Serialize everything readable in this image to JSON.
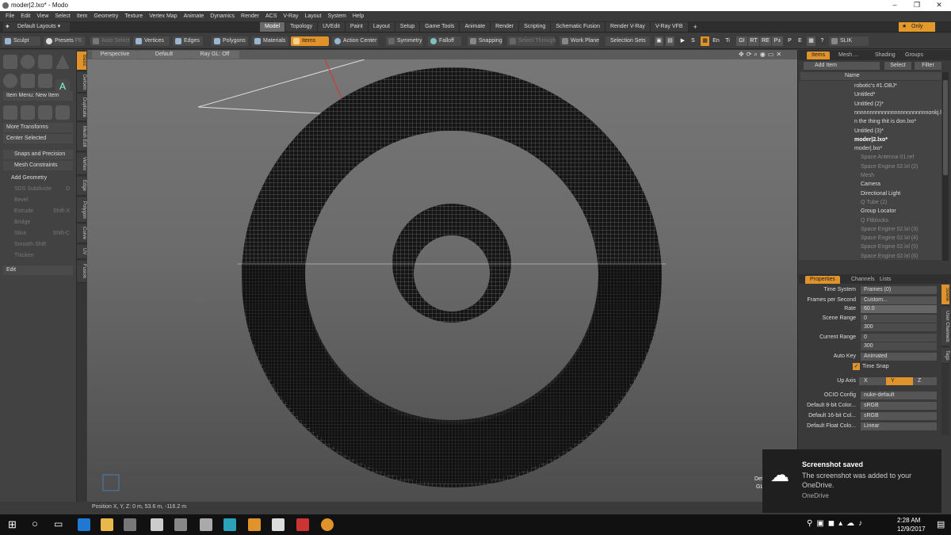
{
  "window": {
    "title": "moder|2.lxo* - Modo",
    "min": "–",
    "max": "❐",
    "close": "✕"
  },
  "menu": [
    "File",
    "Edit",
    "View",
    "Select",
    "Item",
    "Geometry",
    "Texture",
    "Vertex Map",
    "Animate",
    "Dynamics",
    "Render",
    "ACS",
    "V-Ray",
    "Layout",
    "System",
    "Help"
  ],
  "layout": {
    "selector": "Default Layouts ▾",
    "tabs": [
      "Model",
      "Topology",
      "UVEdit",
      "Paint",
      "Layout",
      "Setup",
      "Game Tools",
      "Animate",
      "Render",
      "Scripting",
      "Schematic Fusion",
      "Render V-Ray",
      "V-Ray VFB"
    ],
    "active": "Model",
    "add": "+",
    "only": "Only"
  },
  "toolbar": {
    "sculpt": "Sculpt",
    "presets": "Presets",
    "presets_key": "F6",
    "autoselect": "Auto Select",
    "vertices": "Vertices",
    "edges": "Edges",
    "polygons": "Polygons",
    "materials": "Materials",
    "items": "Items",
    "action_center": "Action Center",
    "symmetry": "Symmetry",
    "falloff": "Falloff",
    "snapping": "Snapping",
    "select_through": "Select Through",
    "work_plane": "Work Plane",
    "selection_sets": "Selection Sets",
    "s": "S",
    "en": "En",
    "ti": "Ti",
    "gi": "GI",
    "rt": "RT",
    "re": "RE",
    "pt": "P±",
    "p": "P",
    "e": "E",
    "help": "?",
    "slik": "SLIK"
  },
  "left": {
    "item_menu": "Item Menu: New Item",
    "more_transforms": "More Transforms",
    "center_selected": "Center Selected",
    "snaps": "Snaps and Precision",
    "mesh_constraints": "Mesh Constraints",
    "add_geometry": "Add Geometry",
    "sds": "SDS Subdivide",
    "sds_key": "D",
    "bevel": "Bevel",
    "extrude": "Extrude",
    "extrude_key": "Shift-X",
    "bridge": "Bridge",
    "slice": "Slice",
    "slice_key": "Shift-C",
    "smooth_shift": "Smooth Shift",
    "thicken": "Thicken",
    "edit": "Edit",
    "vtabs": [
      "Basic",
      "Deform",
      "Duplicate",
      "Mesh Edit",
      "Vertex",
      "Edge",
      "Polygon",
      "Curve",
      "UV",
      "Fusion"
    ]
  },
  "viewport": {
    "perspective": "Perspective",
    "default": "Default",
    "ray_gl": "Ray GL: Off",
    "corner_a": "Def",
    "corner_b": "GL"
  },
  "status": "Position X, Y, Z:   0 m, 53.6 m, -116.2 m",
  "items": {
    "tabs": [
      "Items",
      "Mesh ...",
      "Shading",
      "Groups"
    ],
    "add_item": "Add Item",
    "select": "Select",
    "filter": "Filter",
    "name_col": "Name",
    "rows": [
      {
        "name": "robotic's #1.OBJ*",
        "style": "normal",
        "indent": 0
      },
      {
        "name": "Untitled*",
        "style": "normal",
        "indent": 0
      },
      {
        "name": "Untitled (2)*",
        "style": "normal",
        "indent": 0
      },
      {
        "name": "nnnnnnnnnnnnnnnnnnnnnnnnonkj.lxo*",
        "style": "normal",
        "indent": 0
      },
      {
        "name": "n the thing thit is don.lxo*",
        "style": "normal",
        "indent": 0
      },
      {
        "name": "Untitled (3)*",
        "style": "normal",
        "indent": 0
      },
      {
        "name": "moder|2.lxo*",
        "style": "bold",
        "indent": 0
      },
      {
        "name": "moder|.lxo*",
        "style": "normal",
        "indent": 0
      },
      {
        "name": "Space Antenna 01.ref",
        "style": "dim",
        "indent": 1
      },
      {
        "name": "Space Engine 02.lxl (2)",
        "style": "dim",
        "indent": 1
      },
      {
        "name": "Mesh",
        "style": "dim",
        "indent": 1
      },
      {
        "name": "Camera",
        "style": "normal",
        "indent": 1
      },
      {
        "name": "Directional Light",
        "style": "normal",
        "indent": 1
      },
      {
        "name": "Q Tube (2)",
        "style": "dim",
        "indent": 1
      },
      {
        "name": "Group Locator",
        "style": "normal",
        "indent": 1
      },
      {
        "name": "Q Fitblocks",
        "style": "dim",
        "indent": 1
      },
      {
        "name": "Space Engine 02.lxl (3)",
        "style": "dim",
        "indent": 1
      },
      {
        "name": "Space Engine 02.lxl (4)",
        "style": "dim",
        "indent": 1
      },
      {
        "name": "Space Engine 02.lxl (5)",
        "style": "dim",
        "indent": 1
      },
      {
        "name": "Space Engine 02.lxl (6)",
        "style": "dim",
        "indent": 1
      }
    ]
  },
  "props": {
    "tabs": [
      "Properties",
      "Channels",
      "Lists"
    ],
    "vtabs": [
      "Scene",
      "User Channels",
      "Tags"
    ],
    "time_system_l": "Time System",
    "time_system": "Frames (0)",
    "fps_l": "Frames per Second",
    "fps": "Custom...",
    "rate_l": "Rate",
    "rate": "60.0",
    "scene_range_l": "Scene Range",
    "scene_a": "0",
    "scene_b": "300",
    "current_range_l": "Current Range",
    "cur_a": "0",
    "cur_b": "300",
    "auto_key_l": "Auto Key",
    "auto_key": "Animated",
    "time_snap": "Time Snap",
    "up_axis_l": "Up Axis",
    "ax_x": "X",
    "ax_y": "Y",
    "ax_z": "Z",
    "ocio_l": "OCIO Config",
    "ocio": "nuke-default",
    "c8_l": "Default 8-bit Color...",
    "c8": "sRGB",
    "c16_l": "Default 16-bit Col...",
    "c16": "sRGB",
    "cf_l": "Default Float Colo...",
    "cf": "Linear"
  },
  "toast": {
    "title": "Screenshot saved",
    "body": "The screenshot was added to your OneDrive.",
    "app": "OneDrive"
  },
  "clock": {
    "time": "2:28 AM",
    "date": "12/9/2017"
  }
}
